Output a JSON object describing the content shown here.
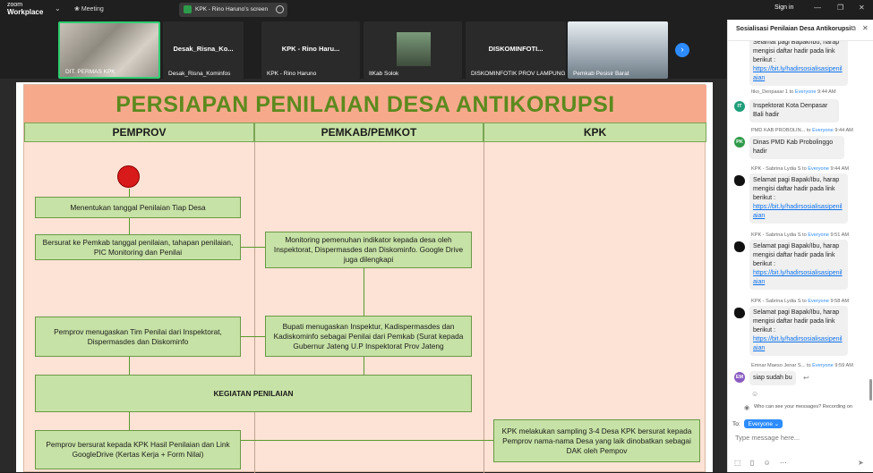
{
  "topbar": {
    "brand_small": "zoom",
    "brand_big": "Workplace",
    "meeting_label": "Meeting",
    "share_label": "KPK - Rino Haruno's screen",
    "signin": "Sign in"
  },
  "participants": [
    {
      "label": "DIT. PERMAS KPK"
    },
    {
      "label": "Desak_Risna_Kominfos",
      "display": "Desak_Risna_Ko..."
    },
    {
      "label": "KPK - Rino Haruno",
      "display": "KPK - Rino Haru..."
    },
    {
      "label": "ItKab Solok"
    },
    {
      "label": "DISKOMINFOTIK PROV LAMPUNG",
      "display": "DISKOMINFOTI..."
    },
    {
      "label": "Pemkab Pesisir Barat"
    }
  ],
  "slide": {
    "title": "PERSIAPAN PENILAIAN DESA ANTIKORUPSI",
    "columns": [
      "PEMPROV",
      "PEMKAB/PEMKOT",
      "KPK"
    ],
    "boxes": {
      "b1": "Menentukan tanggal Penilaian Tiap Desa",
      "b2": "Bersurat ke Pemkab tanggal penilaian, tahapan penilaian, PIC Monitoring dan Penilai",
      "b3": "Monitoring pemenuhan indikator kepada desa oleh Inspektorat, Dispermasdes dan Diskominfo. Google Drive juga dilengkapi",
      "b4": "Pemprov menugaskan Tim Penilai dari Inspektorat, Dispermasdes dan Diskominfo",
      "b5": "Bupati menugaskan Inspektur, Kadispermasdes dan Kadiskominfo sebagai Penilai dari Pemkab (Surat kepada Gubernur Jateng U.P Inspektorat Prov Jateng",
      "b6": "KEGIATAN PENILAIAN",
      "b7": "Pemprov  bersurat kepada KPK Hasil Penilaian dan Link GoogleDrive (Kertas Kerja + Form Nilai)",
      "b8": "KPK melakukan sampling 3-4 Desa KPK bersurat kepada Pemprov nama-nama Desa yang laik dinobatkan sebagai DAK oleh Pempov"
    }
  },
  "chat": {
    "title": "Sosialisasi Penilaian Desa Antikorupsi",
    "messages": [
      {
        "text": "Selamat pagi Bapak/Ibu, harap mengisi daftar hadir pada link berikut :",
        "link": "https://bit.ly/hadirsosialisasipenilaian"
      },
      {
        "sender": "Itko_Denpasar 1",
        "to": "to",
        "recipient": "Everyone",
        "time": "9:44 AM",
        "initials": "IT",
        "color": "#1e9e7a",
        "text": "Inspektorat Kota Denpasar Bali hadir"
      },
      {
        "sender": "PMD KAB PROBOLIN...",
        "to": "to",
        "recipient": "Everyone",
        "time": "9:44 AM",
        "initials": "PK",
        "color": "#2e9b4a",
        "text": "Dinas PMD Kab Probolinggo hadir"
      },
      {
        "sender": "KPK - Sabrina Lydia S",
        "to": "to",
        "recipient": "Everyone",
        "time": "9:44 AM",
        "text": "Selamat pagi Bapak/Ibu, harap mengisi daftar hadir pada link berikut :",
        "link": "https://bit.ly/hadirsosialisasipenilaian"
      },
      {
        "sender": "KPK - Sabrina Lydia S",
        "to": "to",
        "recipient": "Everyone",
        "time": "9:51 AM",
        "text": "Selamat pagi Bapak/Ibu, harap mengisi daftar hadir pada link berikut :",
        "link": "https://bit.ly/hadirsosialisasipenilaian"
      },
      {
        "sender": "KPK - Sabrina Lydia S",
        "to": "to",
        "recipient": "Everyone",
        "time": "9:58 AM",
        "text": "Selamat pagi Bapak/Ibu, harap mengisi daftar hadir pada link berikut :",
        "link": "https://bit.ly/hadirsosialisasipenilaian"
      },
      {
        "sender": "Emnar Maeso Jenar S...",
        "to": "to",
        "recipient": "Everyone",
        "time": "9:59 AM",
        "initials": "EM",
        "color": "#8a5cc2",
        "text": "siap sudah bu"
      }
    ],
    "info": "Who can see your messages? Recording on",
    "to_label": "To:",
    "to_value": "Everyone",
    "placeholder": "Type message here..."
  },
  "colors": {
    "accent": "#2d8cff",
    "box_green": "#c7e2a6",
    "slide_bg": "#fde3d5",
    "title_bg": "#f7a98c",
    "title_text": "#5c8a1e"
  }
}
